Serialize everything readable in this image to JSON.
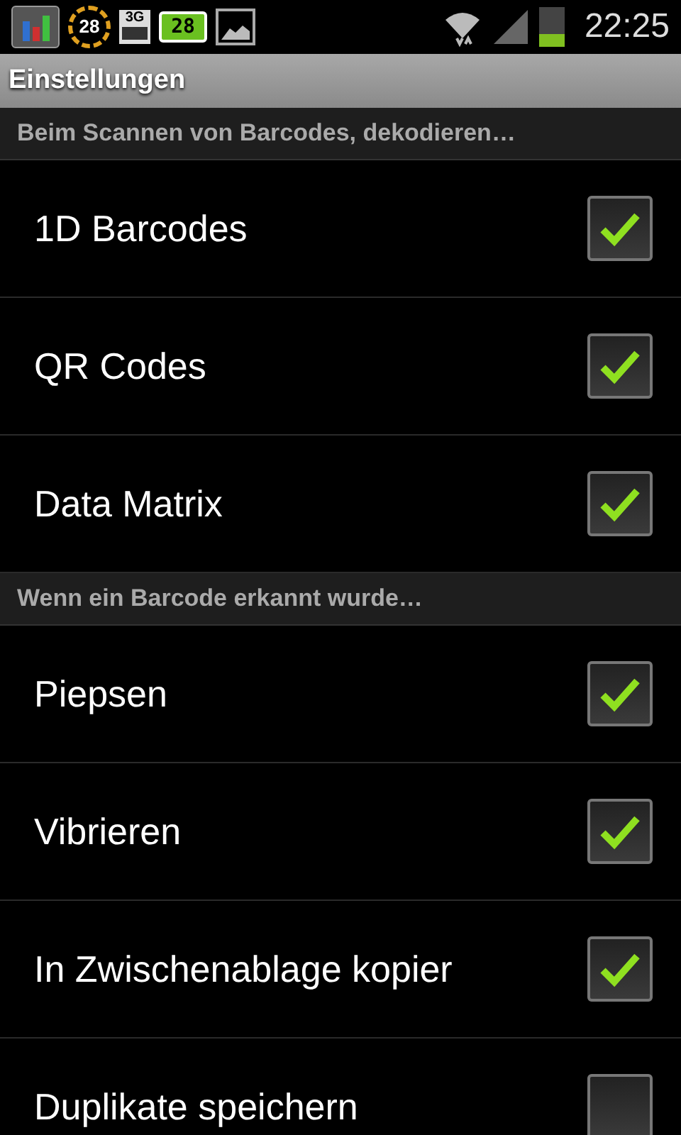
{
  "status_bar": {
    "notifications": [
      {
        "kind": "chart"
      },
      {
        "kind": "dial",
        "text": "28"
      },
      {
        "kind": "network",
        "text": "3G"
      },
      {
        "kind": "counter",
        "text": "28"
      },
      {
        "kind": "image"
      }
    ],
    "time": "22:25"
  },
  "title": "Einstellungen",
  "sections": [
    {
      "header": "Beim Scannen von Barcodes, dekodieren…",
      "items": [
        {
          "label": "1D Barcodes",
          "checked": true
        },
        {
          "label": "QR Codes",
          "checked": true
        },
        {
          "label": "Data Matrix",
          "checked": true
        }
      ]
    },
    {
      "header": "Wenn ein Barcode erkannt wurde…",
      "items": [
        {
          "label": "Piepsen",
          "checked": true
        },
        {
          "label": "Vibrieren",
          "checked": true
        },
        {
          "label": "In Zwischenablage kopier",
          "checked": true
        },
        {
          "label": "Duplikate speichern",
          "checked": false
        }
      ]
    }
  ]
}
